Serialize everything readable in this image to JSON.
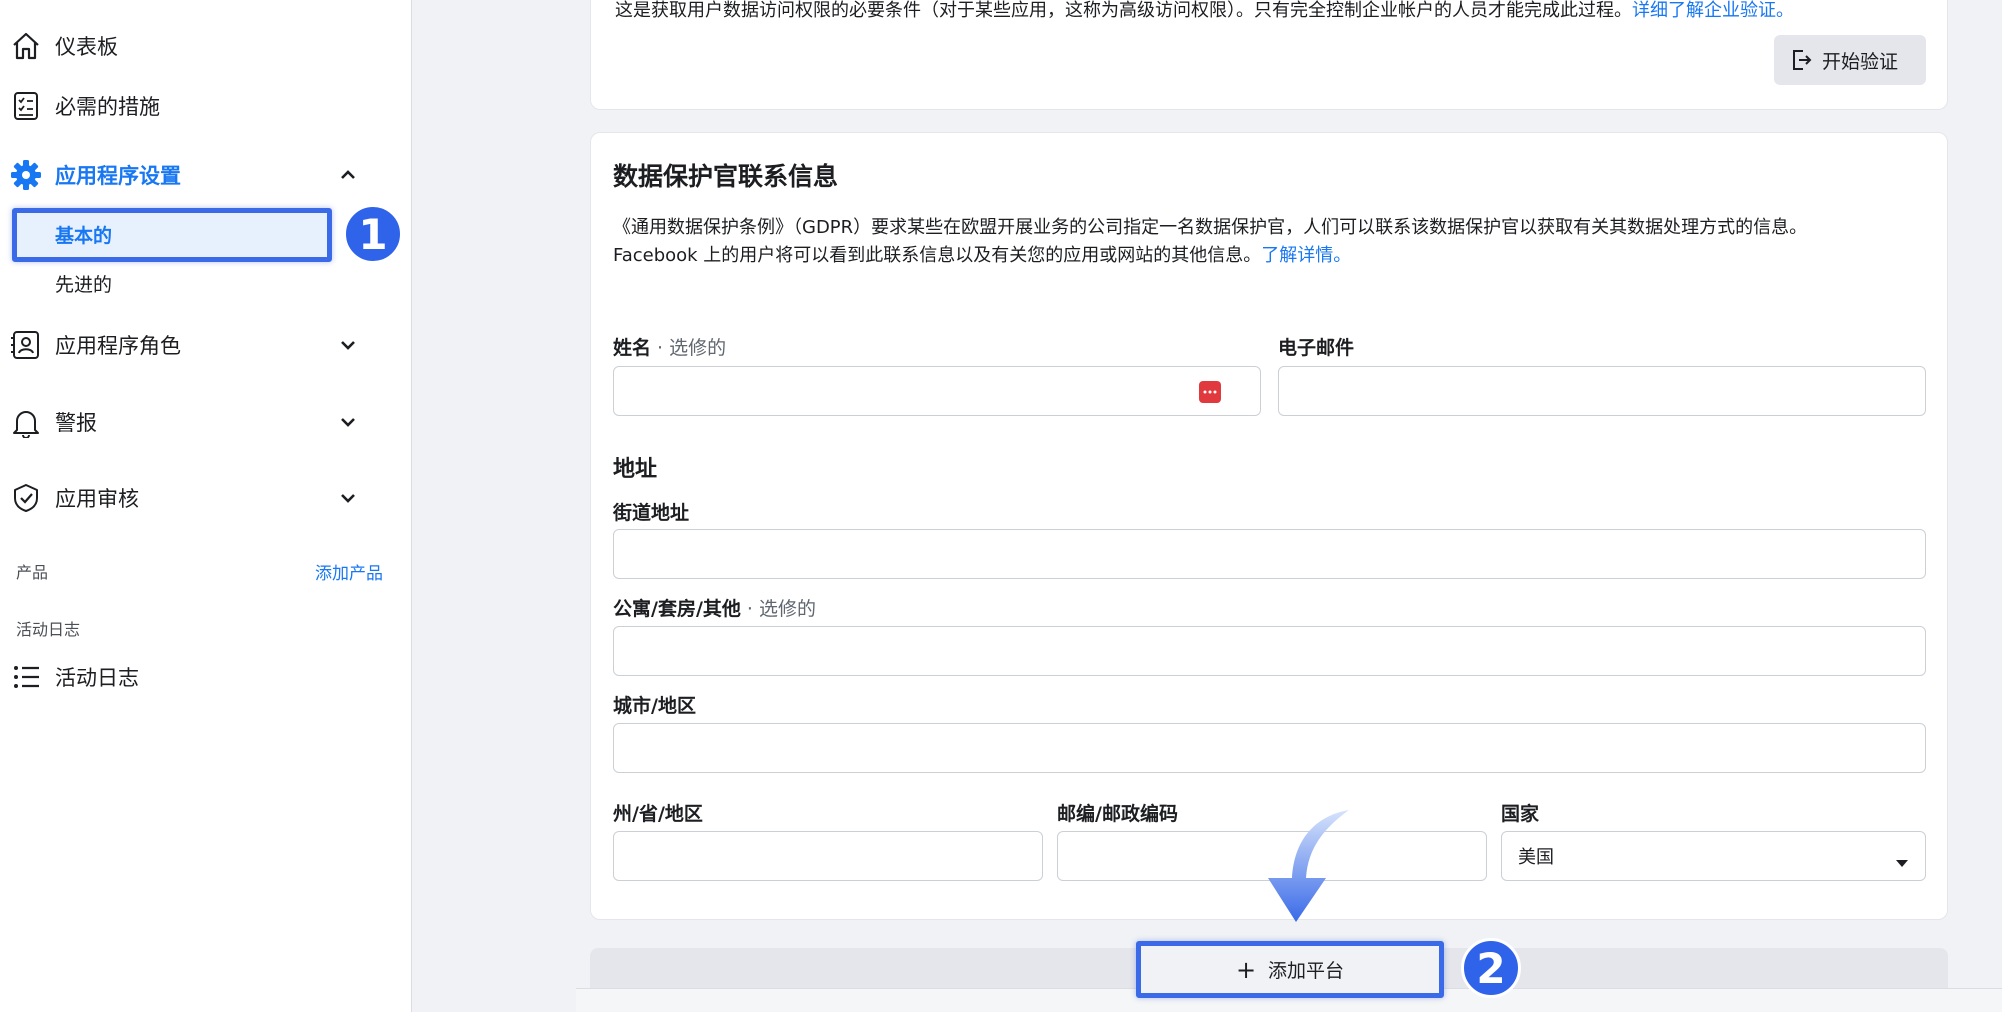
{
  "sidebar": {
    "dashboard": "仪表板",
    "required_actions": "必需的措施",
    "app_settings": "应用程序设置",
    "basic": "基本的",
    "advanced": "先进的",
    "app_roles": "应用程序角色",
    "alerts": "警报",
    "app_review": "应用审核",
    "products_header": "产品",
    "add_product": "添加产品",
    "activity_log_header": "活动日志",
    "activity_log": "活动日志"
  },
  "top_card": {
    "partial_text": "这是获取用户数据访问权限的必要条件（对于某些应用，这称为高级访问权限）。只有完全控制企业帐户的人员才能完成此过程。",
    "partial_link": "详细了解企业验证。",
    "start_button": "开始验证"
  },
  "dpo_card": {
    "title": "数据保护官联系信息",
    "desc1": "《通用数据保护条例》（GDPR）要求某些在欧盟开展业务的公司指定一名数据保护官，人们可以联系该数据保护官以获取有关其数据处理方式的信息。",
    "desc2": "Facebook 上的用户将可以看到此联系信息以及有关您的应用或网站的其他信息。",
    "learn_more": "了解详情。",
    "name_label": "姓名",
    "optional_suffix": " · 选修的",
    "email_label": "电子邮件",
    "address_header": "地址",
    "street_label": "街道地址",
    "apt_label": "公寓/套房/其他",
    "city_label": "城市/地区",
    "state_label": "州/省/地区",
    "zip_label": "邮编/邮政编码",
    "country_label": "国家",
    "country_value": "美国"
  },
  "add_platform": "添加平台",
  "annotations": {
    "step1": "1",
    "step2": "2"
  },
  "colors": {
    "accent": "#1877f2",
    "highlight": "#3a6ae8",
    "password_icon": "#e03a3e"
  }
}
